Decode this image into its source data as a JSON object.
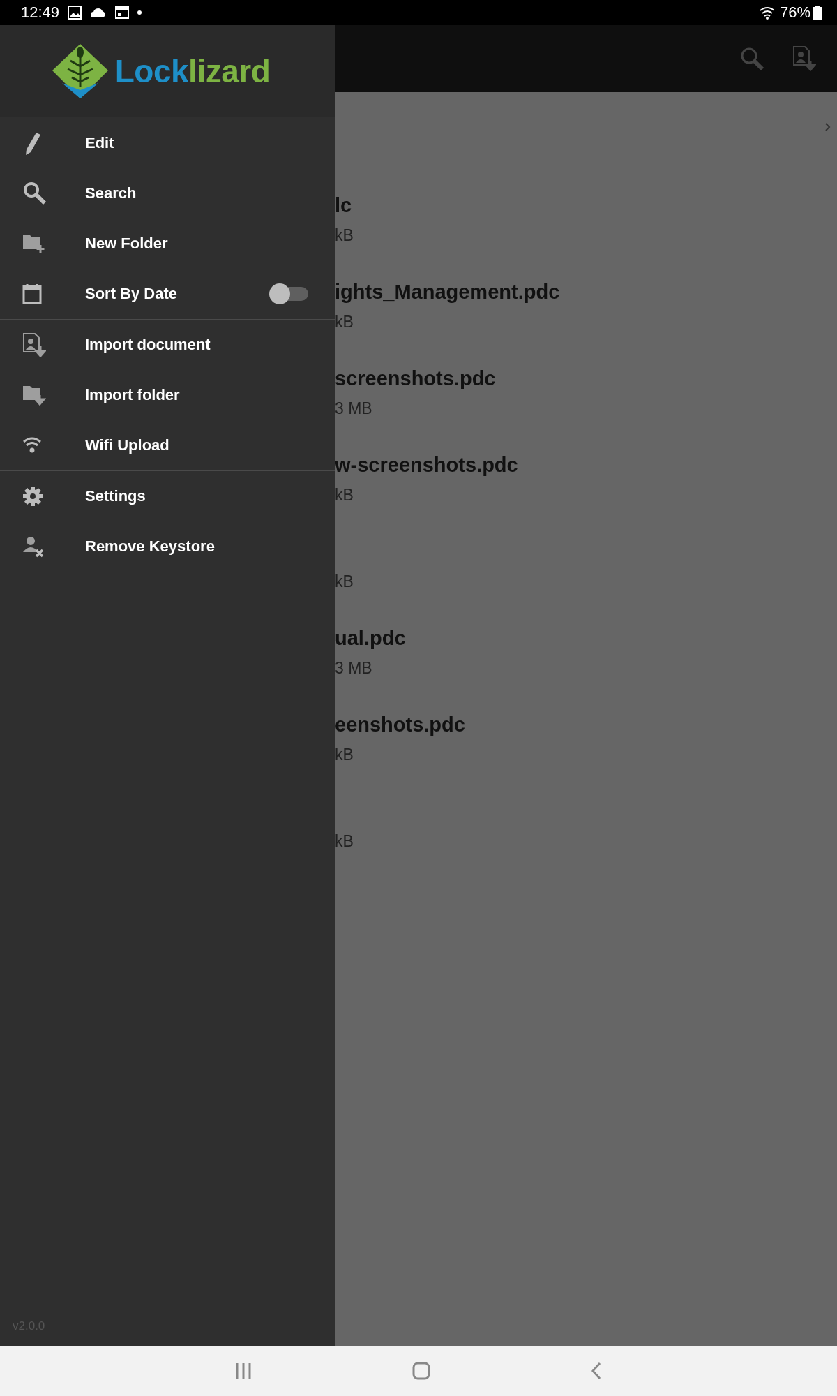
{
  "status_bar": {
    "time": "12:49",
    "battery": "76%"
  },
  "drawer": {
    "logo": {
      "parts": [
        "Lock",
        "lizard"
      ]
    },
    "groups": [
      {
        "items": [
          {
            "label": "Edit",
            "kind": "action"
          },
          {
            "label": "Search",
            "kind": "action"
          },
          {
            "label": "New Folder",
            "kind": "action"
          },
          {
            "label": "Sort By Date",
            "kind": "toggle",
            "on": false
          }
        ]
      },
      {
        "items": [
          {
            "label": "Import document",
            "kind": "action"
          },
          {
            "label": "Import folder",
            "kind": "action"
          },
          {
            "label": "Wifi Upload",
            "kind": "action"
          }
        ]
      },
      {
        "items": [
          {
            "label": "Settings",
            "kind": "action"
          },
          {
            "label": "Remove Keystore",
            "kind": "action"
          }
        ]
      }
    ],
    "version": "v2.0.0"
  },
  "files": [
    {
      "name": "lc",
      "size": "kB"
    },
    {
      "name": "ights_Management.pdc",
      "size": "kB"
    },
    {
      "name": "screenshots.pdc",
      "size": "3 MB"
    },
    {
      "name": "w-screenshots.pdc",
      "size": "kB"
    },
    {
      "size": "kB"
    },
    {
      "name": "ual.pdc",
      "size": "3 MB"
    },
    {
      "name": "eenshots.pdc",
      "size": "kB"
    },
    {
      "size": "kB"
    }
  ]
}
